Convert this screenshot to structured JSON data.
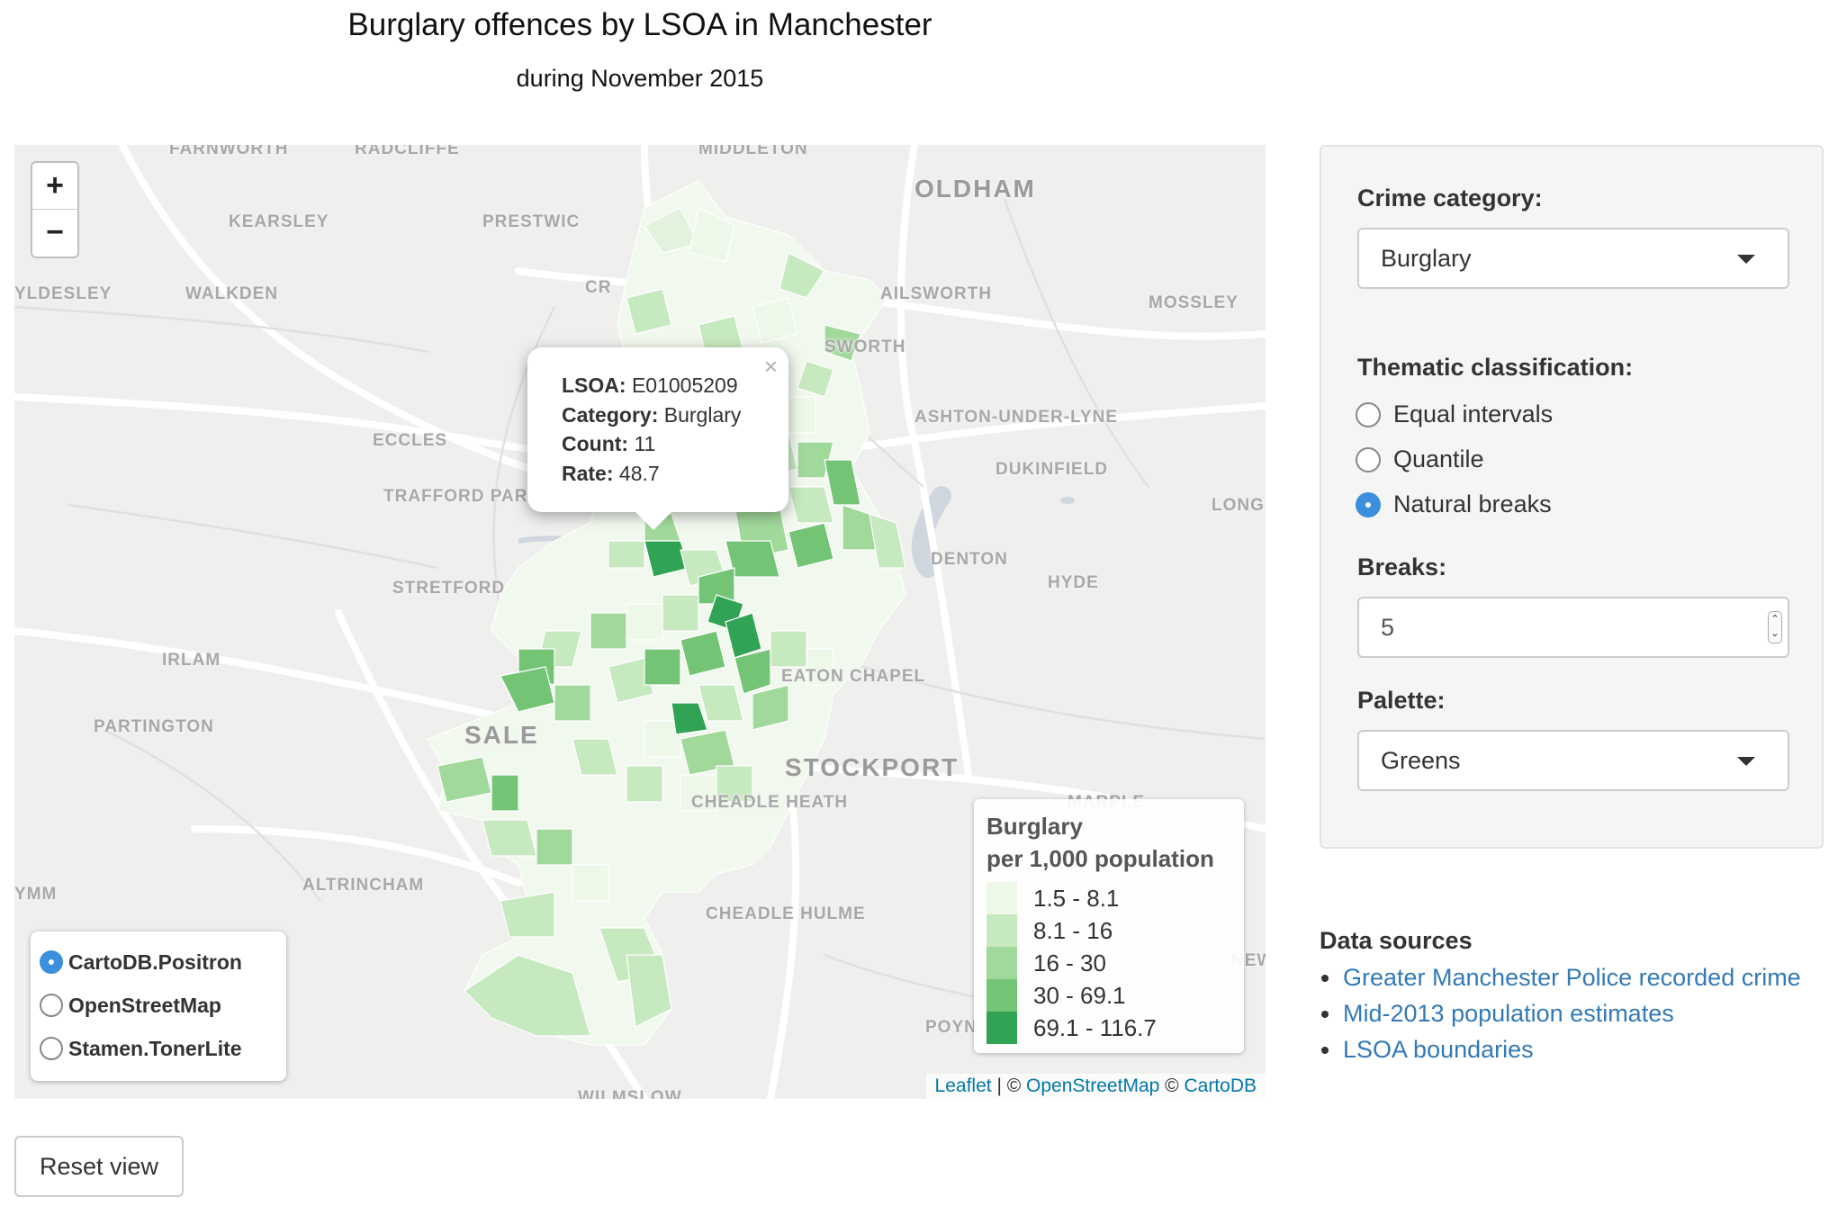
{
  "header": {
    "title": "Burglary offences by LSOA in Manchester",
    "subtitle": "during November 2015"
  },
  "map": {
    "zoom_in_label": "+",
    "zoom_out_label": "−",
    "place_names": [
      "FARNWORTH",
      "RADCLIFFE",
      "MIDDLETON",
      "OLDHAM",
      "KEARSLEY",
      "PRESTWIC",
      "YLDESLEY",
      "WALKDEN",
      "CR",
      "AILSWORTH",
      "MOSSLEY",
      "SWORTH",
      "ASHTON-UNDER-LYNE",
      "ECCLES",
      "DUKINFIELD",
      "TRAFFORD PAR",
      "LONG",
      "DENTON",
      "HYDE",
      "STRETFORD",
      "IRLAM",
      "EATON CHAPEL",
      "PARTINGTON",
      "SALE",
      "STOCKPORT",
      "CHEADLE HEATH",
      "MARPLE",
      "ALTRINCHAM",
      "YMM",
      "CHEADLE HULME",
      "NEW",
      "POYN",
      "WILMSLOW"
    ],
    "popup": {
      "lsoa_label": "LSOA:",
      "lsoa_value": "E01005209",
      "category_label": "Category:",
      "category_value": "Burglary",
      "count_label": "Count:",
      "count_value": "11",
      "rate_label": "Rate:",
      "rate_value": "48.7",
      "close_label": "×"
    },
    "legend": {
      "title_line1": "Burglary",
      "title_line2": "per 1,000 population",
      "classes": [
        {
          "label": "1.5 - 8.1",
          "color": "#edf8e9"
        },
        {
          "label": "8.1 - 16",
          "color": "#c7e9c0"
        },
        {
          "label": "16 - 30",
          "color": "#a1d99b"
        },
        {
          "label": "30 - 69.1",
          "color": "#74c476"
        },
        {
          "label": "69.1 - 116.7",
          "color": "#31a354"
        }
      ]
    },
    "base_layers": [
      {
        "label": "CartoDB.Positron",
        "selected": true
      },
      {
        "label": "OpenStreetMap",
        "selected": false
      },
      {
        "label": "Stamen.TonerLite",
        "selected": false
      }
    ],
    "attribution": {
      "leaflet": "Leaflet",
      "sep1": " | © ",
      "osm": "OpenStreetMap",
      "sep2": " © ",
      "carto": "CartoDB"
    }
  },
  "controls": {
    "crime_category_label": "Crime category:",
    "crime_category_value": "Burglary",
    "classification_label": "Thematic classification:",
    "classification_options": [
      {
        "label": "Equal intervals",
        "selected": false
      },
      {
        "label": "Quantile",
        "selected": false
      },
      {
        "label": "Natural breaks",
        "selected": true
      }
    ],
    "breaks_label": "Breaks:",
    "breaks_value": "5",
    "palette_label": "Palette:",
    "palette_value": "Greens"
  },
  "data_sources": {
    "title": "Data sources",
    "links": [
      "Greater Manchester Police recorded crime",
      "Mid-2013 population estimates",
      "LSOA boundaries"
    ]
  },
  "reset_button": "Reset view",
  "colors": {
    "accent": "#3b8fdc",
    "link": "#337ab7",
    "map_background": "#efefee"
  }
}
